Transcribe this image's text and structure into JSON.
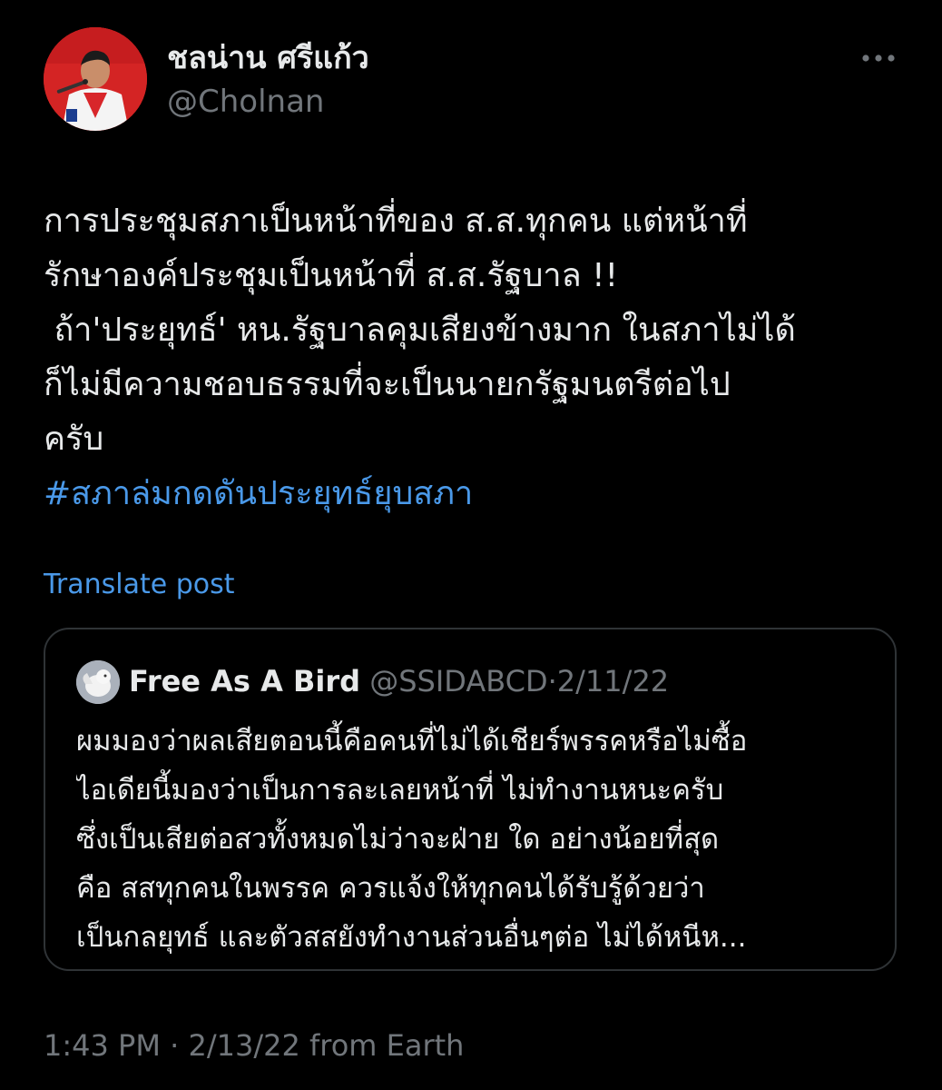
{
  "author": {
    "display_name": "ชลน่าน ศรีแก้ว",
    "handle": "@Cholnan"
  },
  "post": {
    "lines": [
      "การประชุมสภาเป็นหน้าที่ของ ส.ส.ทุกคน แต่หน้าที่",
      "รักษาองค์ประชุมเป็นหน้าที่ ส.ส.รัฐบาล !!",
      " ถ้า'ประยุทธ์' หน.รัฐบาลคุมเสียงข้างมาก ในสภาไม่ได้",
      "ก็ไม่มีความชอบธรรมที่จะเป็นนายกรัฐมนตรีต่อไป",
      "ครับ"
    ],
    "hashtag": "#สภาล่มกดดันประยุทธ์ยุบสภา",
    "translate_label": "Translate post"
  },
  "quote": {
    "name": "Free As A Bird",
    "handle": "@SSIDABCD",
    "separator": "·",
    "date": "2/11/22",
    "lines": [
      "ผมมองว่าผลเสียตอนนี้คือคนที่ไม่ได้เชียร์พรรคหรือไม่ซื้อ",
      "ไอเดียนี้มองว่าเป็นการละเลยหน้าที่ ไม่ทำงานหนะครับ",
      "ซึ่งเป็นเสียต่อสวทั้งหมดไม่ว่าจะฝ่าย ใด อย่างน้อยที่สุด",
      "คือ สสทุกคนในพรรค ควรแจ้งให้ทุกคนได้รับรู้ด้วยว่า",
      "เป็นกลยุทธ์ และตัวสสยังทำงานส่วนอื่นๆต่อ ไม่ได้หนีห..."
    ]
  },
  "timestamp": "1:43 PM · 2/13/22 from Earth",
  "icons": {
    "more": "more-horizontal-icon",
    "avatar": "profile-photo",
    "quote_avatar": "profile-photo-bird"
  },
  "colors": {
    "background": "#000000",
    "text": "#e7e9ea",
    "muted": "#71767b",
    "link": "#4a99e9",
    "border": "#2f3336"
  }
}
